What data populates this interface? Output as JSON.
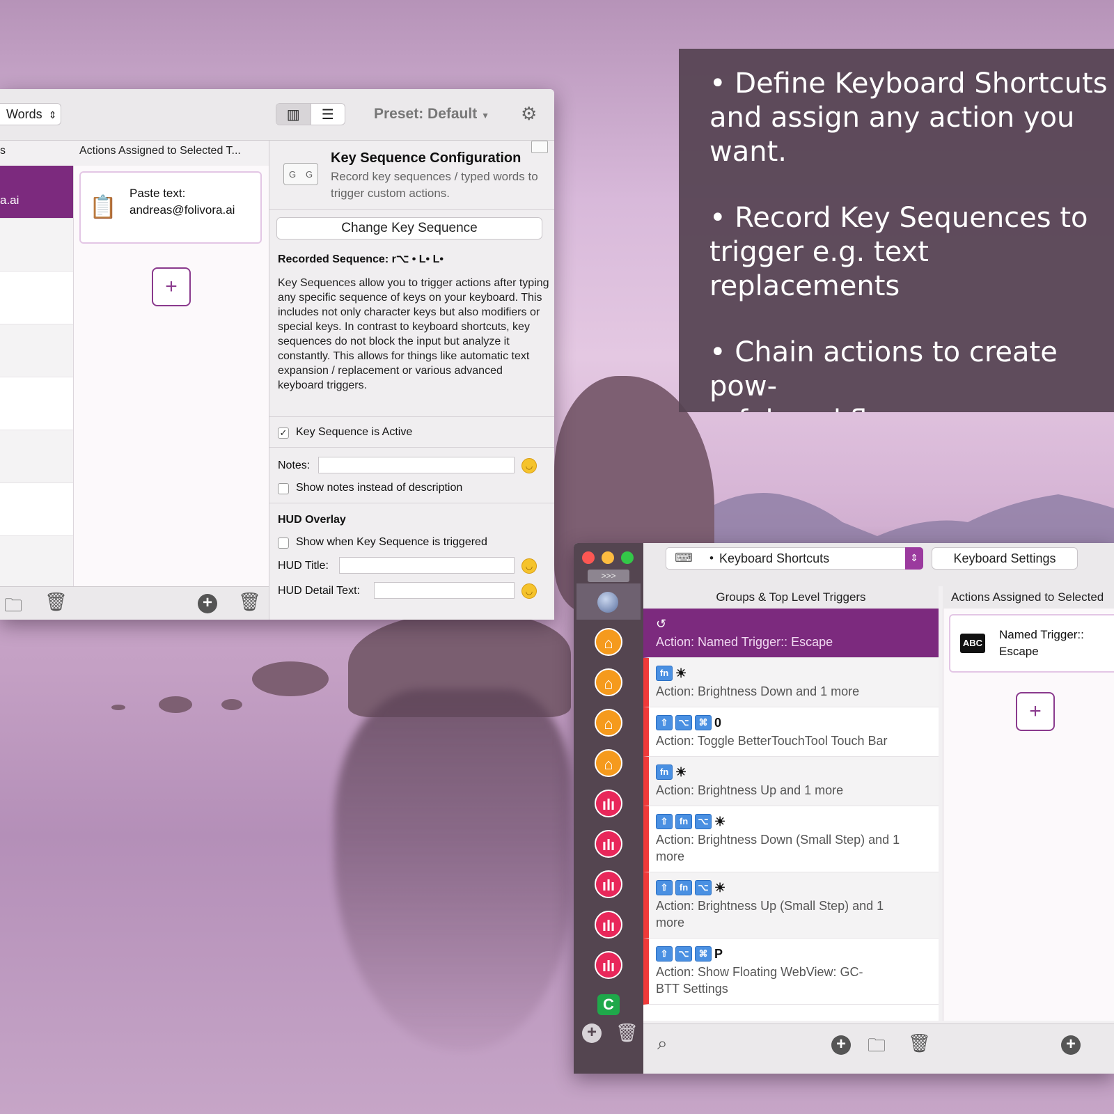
{
  "info": {
    "lines": [
      "• Define Keyboard Shortcuts",
      "and assign any action you",
      "want.",
      "• Record Key Sequences to",
      "trigger e.g. text replacements",
      "• Chain actions to create pow-",
      "erful workflows"
    ]
  },
  "w1": {
    "trigger_type": "Words",
    "preset": "Preset: Default",
    "col_left": "s",
    "col_actions": "Actions Assigned to Selected T...",
    "selected_item": "a.ai",
    "action_card": "Paste text: andreas@folivora.ai",
    "config": {
      "title": "Key Sequence Configuration",
      "subtitle": "Record key sequences / typed words to trigger custom actions.",
      "change_button": "Change Key Sequence",
      "recorded": "Recorded Sequence: r⌥ • L• L•",
      "description": "Key Sequences allow you to trigger actions after typing any specific sequence of keys on your keyboard. This includes not only character keys but also modifiers or special keys. In contrast to keyboard shortcuts, key sequences do not block the input but analyze it constantly. This allows for things like automatic text expansion / replacement or various advanced keyboard triggers.",
      "active_label": "Key Sequence is Active",
      "notes_label": "Notes:",
      "show_notes_label": "Show notes instead of description",
      "hud_heading": "HUD Overlay",
      "hud_show_label": "Show when Key Sequence is triggered",
      "hud_title_label": "HUD Title:",
      "hud_detail_label": "HUD Detail Text:"
    }
  },
  "w2": {
    "more": ">>>",
    "trigger_type": "Keyboard Shortcuts",
    "settings_button": "Keyboard Settings",
    "col_groups": "Groups & Top Level Triggers",
    "col_actions": "Actions Assigned to Selected",
    "triggers": [
      {
        "keys": [],
        "symbol": "↺",
        "label": "Action: Named Trigger:: Escape"
      },
      {
        "keys": [
          "fn"
        ],
        "symbol": "☀",
        "label": "Action: Brightness Down and 1 more"
      },
      {
        "keys": [
          "⇧",
          "⌥",
          "⌘"
        ],
        "symbol": "0",
        "label": "Action: Toggle BetterTouchTool Touch Bar"
      },
      {
        "keys": [
          "fn"
        ],
        "symbol": "☀",
        "label": "Action: Brightness Up and 1 more"
      },
      {
        "keys": [
          "⇧",
          "fn",
          "⌥"
        ],
        "symbol": "☀",
        "label": "Action: Brightness Down  (Small Step) and 1 more"
      },
      {
        "keys": [
          "⇧",
          "fn",
          "⌥"
        ],
        "symbol": "☀",
        "label": "Action: Brightness Up (Small Step) and 1 more"
      },
      {
        "keys": [
          "⇧",
          "⌥",
          "⌘"
        ],
        "symbol": "P",
        "label": "Action: Show Floating WebView: GC-BTT Settings"
      }
    ],
    "action_card": "Named Trigger:: Escape",
    "abc": "ABC"
  }
}
